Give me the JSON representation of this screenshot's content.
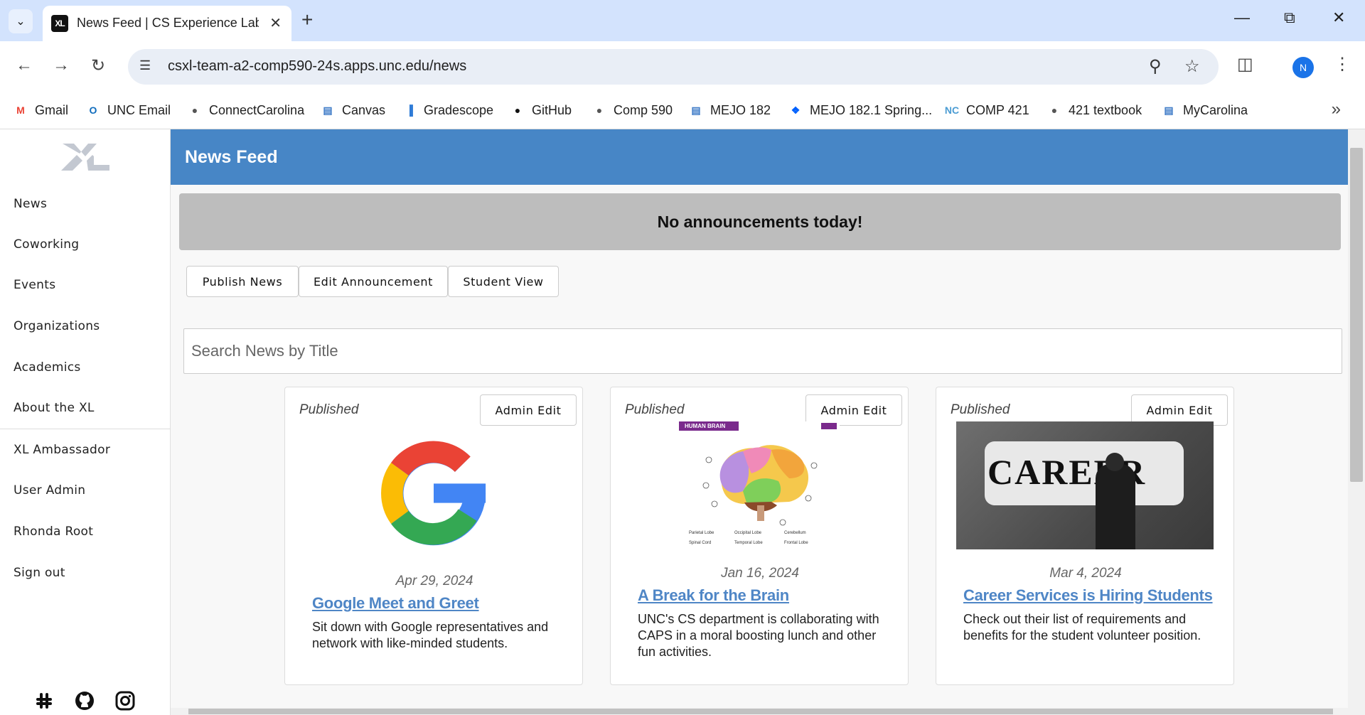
{
  "browser": {
    "tab_title": "News Feed | CS Experience Labs",
    "tab_favicon_text": "XL",
    "url": "csxl-team-a2-comp590-24s.apps.unc.edu/news",
    "profile_initial": "N",
    "bookmarks": [
      {
        "label": "Gmail",
        "icon": "gmail-icon",
        "color": "#ea4335"
      },
      {
        "label": "UNC Email",
        "icon": "outlook-icon",
        "color": "#0f6cbd"
      },
      {
        "label": "ConnectCarolina",
        "icon": "globe-icon",
        "color": "#555"
      },
      {
        "label": "Canvas",
        "icon": "building-icon",
        "color": "#3d7ac7"
      },
      {
        "label": "Gradescope",
        "icon": "bar-chart-icon",
        "color": "#2f7cd7"
      },
      {
        "label": "GitHub",
        "icon": "github-icon",
        "color": "#111"
      },
      {
        "label": "Comp 590",
        "icon": "globe-icon",
        "color": "#555"
      },
      {
        "label": "MEJO 182",
        "icon": "building-icon",
        "color": "#3d7ac7"
      },
      {
        "label": "MEJO 182.1 Spring...",
        "icon": "dropbox-icon",
        "color": "#0061fe"
      },
      {
        "label": "COMP 421",
        "icon": "unc-icon",
        "color": "#4b9cd3"
      },
      {
        "label": "421 textbook",
        "icon": "globe-icon",
        "color": "#555"
      },
      {
        "label": "MyCarolina",
        "icon": "building-icon",
        "color": "#3d7ac7"
      }
    ]
  },
  "sidebar": {
    "items": [
      {
        "label": "News"
      },
      {
        "label": "Coworking"
      },
      {
        "label": "Events"
      },
      {
        "label": "Organizations"
      },
      {
        "label": "Academics"
      },
      {
        "label": "About the XL"
      },
      {
        "label": "XL Ambassador"
      },
      {
        "label": "User Admin"
      },
      {
        "label": "Rhonda Root"
      },
      {
        "label": "Sign out"
      }
    ],
    "social": [
      "slack-icon",
      "github-icon",
      "instagram-icon"
    ]
  },
  "header": {
    "title": "News Feed"
  },
  "announcement": {
    "text": "No announcements today!"
  },
  "actions": {
    "publish": "Publish News",
    "edit_announcement": "Edit Announcement",
    "student_view": "Student View"
  },
  "search": {
    "placeholder": "Search News by Title"
  },
  "colors": {
    "header": "#4786c6",
    "link": "#4f86c6",
    "announcement_bg": "#bdbdbd"
  },
  "posts": [
    {
      "status": "Published",
      "edit_label": "Admin Edit",
      "date": "Apr 29, 2024",
      "title": "Google Meet and Greet",
      "body": "Sit down with Google representatives and network with like-minded students.",
      "image": "google-logo"
    },
    {
      "status": "Published",
      "edit_label": "Admin Edit",
      "date": "Jan 16, 2024",
      "title": "A Break for the Brain",
      "body": "UNC's CS department is collaborating with CAPS in a moral boosting lunch and other fun activities.",
      "image": "brain-diagram",
      "image_header": "HUMAN BRAIN",
      "image_legend": [
        "Parietal Lobe",
        "Occipital Lobe",
        "Cerebellum",
        "Spinal Cord",
        "Temporal Lobe",
        "Frontal Lobe"
      ]
    },
    {
      "status": "Published",
      "edit_label": "Admin Edit",
      "date": "Mar 4, 2024",
      "title": "Career Services is Hiring Students",
      "body": "Check out their list of requirements and benefits for the student volunteer position.",
      "image": "career-puzzle-photo",
      "image_text": "CAREER"
    }
  ]
}
